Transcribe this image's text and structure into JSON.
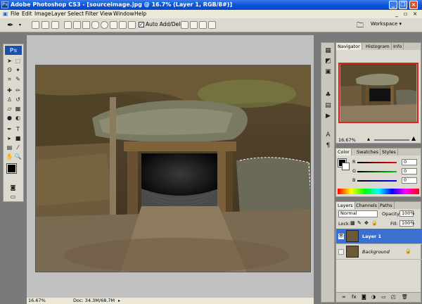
{
  "window": {
    "title": "Adobe Photoshop CS3 - [sourceimage.jpg @ 16.7% (Layer 1, RGB/8#)]",
    "app_icon": "Ps"
  },
  "menu": [
    "File",
    "Edit",
    "Image",
    "Layer",
    "Select",
    "Filter",
    "View",
    "Window",
    "Help"
  ],
  "options": {
    "auto_add_delete": "Auto Add/Delete",
    "workspace": "Workspace ▾"
  },
  "toolbox": {
    "logo": "Ps"
  },
  "status": {
    "zoom": "16.67%",
    "doc": "Doc: 34.3M/68.7M"
  },
  "navigator": {
    "tabs": [
      "Navigator",
      "Histogram",
      "Info"
    ],
    "zoom": "16.67%"
  },
  "color": {
    "tabs": [
      "Color",
      "Swatches",
      "Styles"
    ],
    "channels": [
      {
        "label": "R",
        "value": "0"
      },
      {
        "label": "G",
        "value": "0"
      },
      {
        "label": "B",
        "value": "0"
      }
    ]
  },
  "layers": {
    "tabs": [
      "Layers",
      "Channels",
      "Paths"
    ],
    "blend": "Normal",
    "opacity_label": "Opacity:",
    "opacity": "100%",
    "lock_label": "Lock:",
    "fill_label": "Fill:",
    "fill": "100%",
    "items": [
      {
        "name": "Layer 1",
        "selected": true
      },
      {
        "name": "Background",
        "selected": false
      }
    ]
  }
}
